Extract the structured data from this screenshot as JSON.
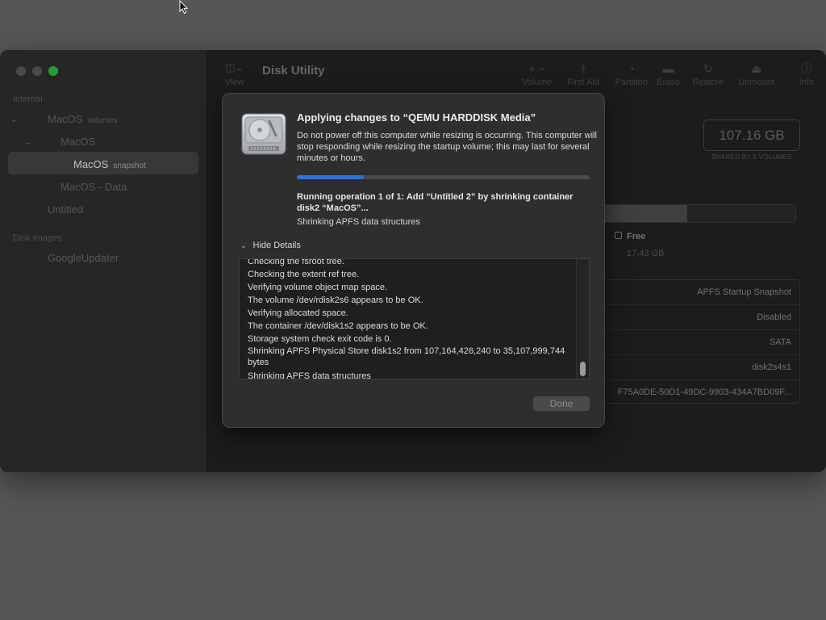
{
  "window": {
    "app_title": "Disk Utility",
    "view_label": "View"
  },
  "sidebar": {
    "internal_header": "Internal",
    "disk_images_header": "Disk Images",
    "items": [
      {
        "label": "MacOS",
        "sub": "volumes"
      },
      {
        "label": "MacOS",
        "sub": ""
      },
      {
        "label": "MacOS",
        "sub": "snapshot"
      },
      {
        "label": "MacOS - Data",
        "sub": ""
      },
      {
        "label": "Untitled",
        "sub": ""
      },
      {
        "label": "GoogleUpdater",
        "sub": ""
      }
    ]
  },
  "toolbar": {
    "volume": "Volume",
    "first_aid": "First Aid",
    "partition": "Partition",
    "erase": "Erase",
    "restore": "Restore",
    "unmount": "Unmount",
    "info": "Info"
  },
  "detail": {
    "capacity": "107.16 GB",
    "capacity_sub": "SHARED BY 5 VOLUMES",
    "used_fraction": 0.48,
    "free_label": "Free",
    "free_value": "17.43 GB",
    "info_rows": [
      "APFS Startup Snapshot",
      "Disabled",
      "SATA",
      "disk2s4s1",
      "F75A0DE-50D1-49DC-9903-434A7BD09F..."
    ]
  },
  "sheet": {
    "title": "Applying changes to “QEMU HARDDISK Media”",
    "message": "Do not power off this computer while resizing is occurring. This computer will stop responding while resizing the startup volume; this may last for several minutes or hours.",
    "progress_fraction": 0.23,
    "operation": "Running operation 1 of 1: Add “Untitled 2” by shrinking container disk2 “MacOS”...",
    "operation_sub": "Shrinking APFS data structures",
    "hide_details": "Hide Details",
    "log": [
      "Checking the fsroot tree.",
      "Checking the extent ref tree.",
      "Verifying volume object map space.",
      "The volume /dev/rdisk2s6 appears to be OK.",
      "Verifying allocated space.",
      "The container /dev/disk1s2 appears to be OK.",
      "Storage system check exit code is 0.",
      "Shrinking APFS Physical Store disk1s2 from 107,164,426,240 to 35,107,999,744 bytes",
      "Shrinking APFS data structures"
    ],
    "done_label": "Done"
  },
  "colors": {
    "progress": "#2e73dc",
    "traffic_max": "#2dc23f"
  }
}
